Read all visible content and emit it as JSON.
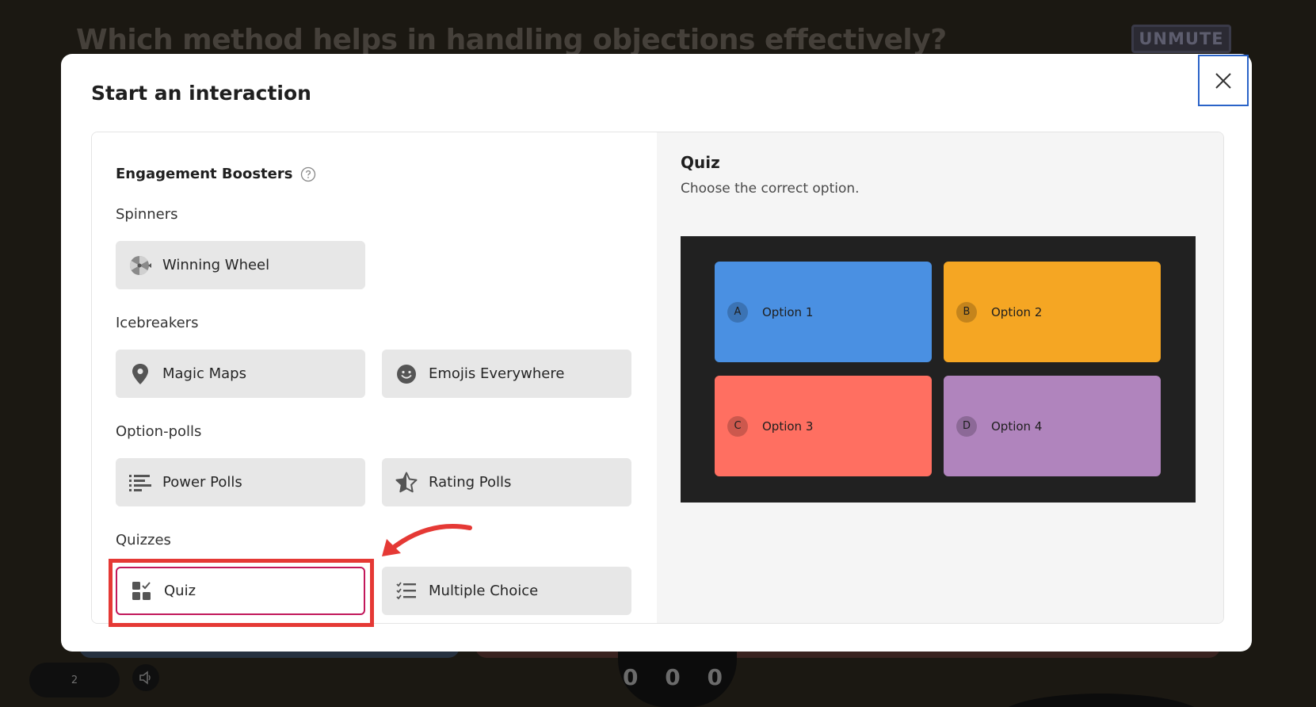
{
  "background": {
    "question": "Which method helps in handling objections effectively?",
    "logo_text": "UNMUTE",
    "counter": "2",
    "score": "0 0 0"
  },
  "modal": {
    "title": "Start an interaction",
    "left": {
      "heading": "Engagement Boosters",
      "groups": [
        {
          "label": "Spinners",
          "tiles": [
            {
              "label": "Winning Wheel",
              "icon": "wheel-icon"
            }
          ]
        },
        {
          "label": "Icebreakers",
          "tiles": [
            {
              "label": "Magic Maps",
              "icon": "map-pin-icon"
            },
            {
              "label": "Emojis Everywhere",
              "icon": "emoji-icon"
            }
          ]
        },
        {
          "label": "Option-polls",
          "tiles": [
            {
              "label": "Power Polls",
              "icon": "poll-bars-icon"
            },
            {
              "label": "Rating Polls",
              "icon": "star-icon"
            }
          ]
        },
        {
          "label": "Quizzes",
          "tiles": [
            {
              "label": "Quiz",
              "icon": "quiz-icon",
              "selected": true
            },
            {
              "label": "Multiple Choice",
              "icon": "checklist-icon"
            }
          ]
        }
      ]
    },
    "preview": {
      "title": "Quiz",
      "description": "Choose the correct option.",
      "options": [
        {
          "letter": "A",
          "label": "Option 1",
          "color": "#4a90e2"
        },
        {
          "letter": "B",
          "label": "Option 2",
          "color": "#f5a623"
        },
        {
          "letter": "C",
          "label": "Option 3",
          "color": "#ff6f61"
        },
        {
          "letter": "D",
          "label": "Option 4",
          "color": "#b084bd"
        }
      ]
    }
  },
  "colors": {
    "highlight": "#e53935",
    "selected_border": "#c2185b",
    "close_focus": "#2a63c8"
  }
}
